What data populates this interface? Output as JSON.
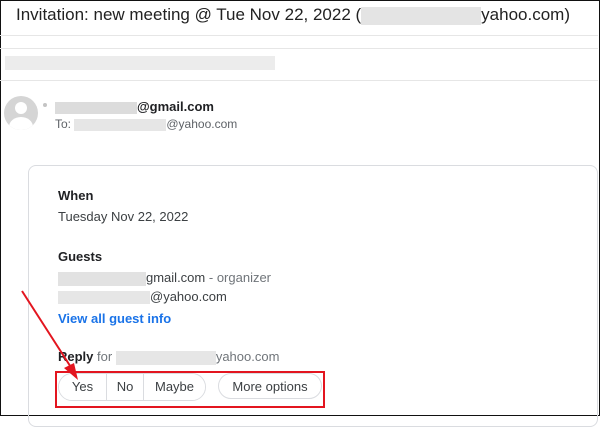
{
  "email": {
    "subject_prefix": "Invitation: new meeting @ Tue Nov 22, 2022 (",
    "subject_suffix": "yahoo.com)",
    "from_suffix": "@gmail.com",
    "to_label": "To:",
    "to_suffix": "@yahoo.com"
  },
  "event": {
    "when_label": "When",
    "when_value": "Tuesday Nov 22, 2022",
    "guests_label": "Guests",
    "organizer_suffix": "gmail.com",
    "organizer_role": "- organizer",
    "guest2_suffix": "@yahoo.com",
    "view_all_link": "View all guest info"
  },
  "reply": {
    "label": "Reply",
    "for_text": "for",
    "email_suffix": "yahoo.com",
    "buttons": {
      "yes": "Yes",
      "no": "No",
      "maybe": "Maybe",
      "more_options": "More options"
    }
  },
  "annotation": {
    "highlight_color": "#e3151f"
  }
}
